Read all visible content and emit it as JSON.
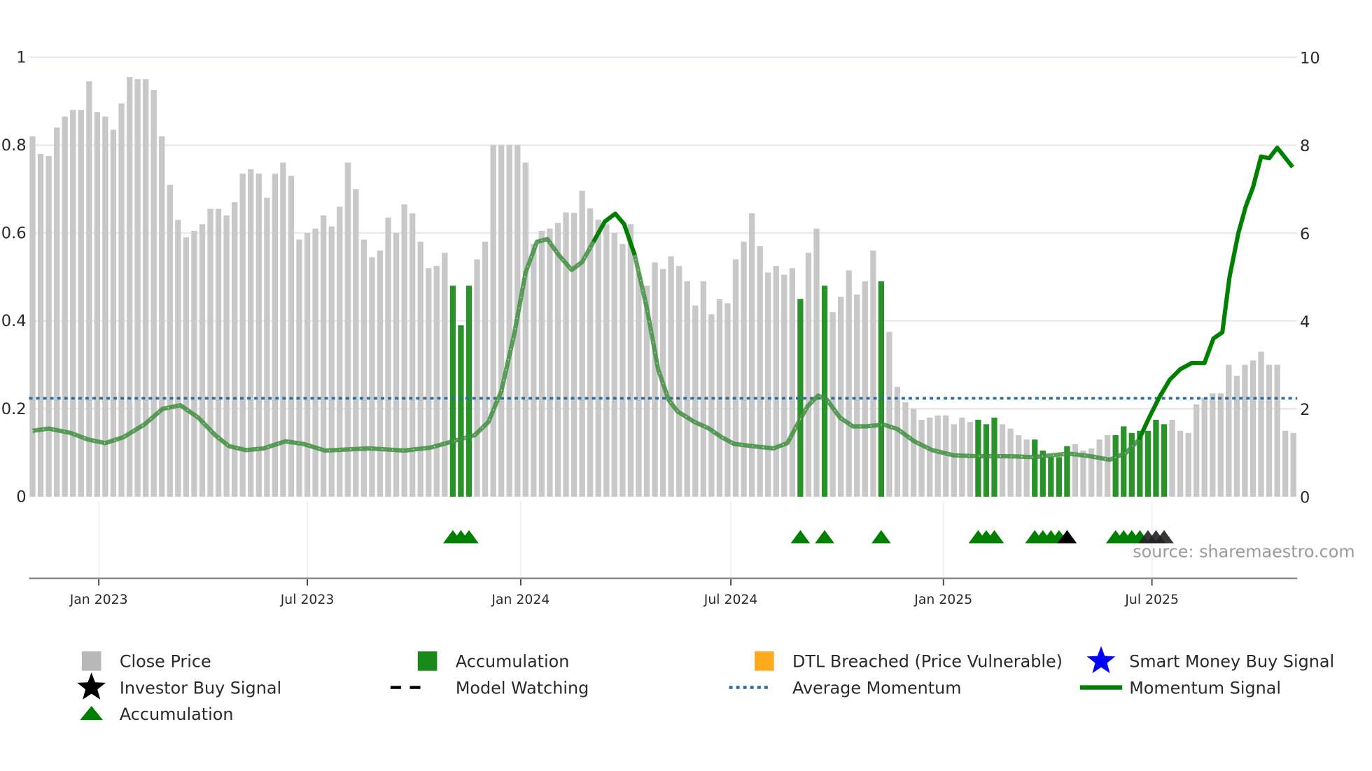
{
  "chart_data": {
    "type": "bar",
    "title": "",
    "source": "source: sharemaestro.com",
    "x_unit": "week index",
    "left_axis": {
      "ylim": [
        0,
        1
      ],
      "ticks": [
        "0",
        "0.2",
        "0.4",
        "0.6",
        "0.8",
        "1"
      ],
      "tick_values": [
        0,
        0.2,
        0.4,
        0.6,
        0.8,
        1
      ]
    },
    "right_axis": {
      "ylim": [
        0,
        10
      ],
      "ticks": [
        "0",
        "2",
        "4",
        "6",
        "8",
        "10"
      ],
      "tick_values": [
        0,
        2,
        4,
        6,
        8,
        10
      ]
    },
    "x_ticks": [
      {
        "label": "Jan 2023",
        "week": 8.2
      },
      {
        "label": "Jul 2023",
        "week": 34.0
      },
      {
        "label": "Jan 2024",
        "week": 60.4
      },
      {
        "label": "Jul 2024",
        "week": 86.4
      },
      {
        "label": "Jan 2025",
        "week": 112.7
      },
      {
        "label": "Jul 2025",
        "week": 138.5
      }
    ],
    "close_price": [
      0.82,
      0.78,
      0.775,
      0.84,
      0.865,
      0.88,
      0.88,
      0.945,
      0.875,
      0.865,
      0.835,
      0.895,
      0.955,
      0.95,
      0.95,
      0.925,
      0.82,
      0.71,
      0.63,
      0.59,
      0.605,
      0.62,
      0.655,
      0.655,
      0.64,
      0.67,
      0.735,
      0.745,
      0.735,
      0.68,
      0.735,
      0.76,
      0.73,
      0.585,
      0.6,
      0.61,
      0.64,
      0.615,
      0.66,
      0.76,
      0.7,
      0.585,
      0.545,
      0.56,
      0.635,
      0.6,
      0.665,
      0.645,
      0.58,
      0.52,
      0.525,
      0.555,
      0.48,
      0.39,
      0.48,
      0.54,
      0.58,
      0.8,
      0.8,
      0.8,
      0.8,
      0.76,
      0.575,
      0.605,
      0.61,
      0.623,
      0.647,
      0.646,
      0.696,
      0.656,
      0.63,
      0.62,
      0.6,
      0.575,
      0.62,
      0.51,
      0.48,
      0.533,
      0.518,
      0.547,
      0.525,
      0.49,
      0.435,
      0.49,
      0.415,
      0.45,
      0.44,
      0.54,
      0.58,
      0.645,
      0.57,
      0.51,
      0.525,
      0.505,
      0.52,
      0.45,
      0.555,
      0.61,
      0.48,
      0.42,
      0.455,
      0.515,
      0.46,
      0.49,
      0.56,
      0.49,
      0.375,
      0.25,
      0.215,
      0.2,
      0.175,
      0.18,
      0.185,
      0.185,
      0.165,
      0.18,
      0.17,
      0.175,
      0.165,
      0.18,
      0.165,
      0.155,
      0.14,
      0.13,
      0.13,
      0.105,
      0.09,
      0.09,
      0.115,
      0.12,
      0.105,
      0.11,
      0.13,
      0.14,
      0.14,
      0.16,
      0.145,
      0.15,
      0.15,
      0.175,
      0.165,
      0.175,
      0.15,
      0.145,
      0.21,
      0.225,
      0.235,
      0.235,
      0.3,
      0.275,
      0.3,
      0.31,
      0.33,
      0.3,
      0.3,
      0.15,
      0.145
    ],
    "accumulation_bars": [
      52,
      53,
      54,
      95,
      98,
      105,
      117,
      118,
      119,
      124,
      125,
      126,
      127,
      128,
      134,
      135,
      136,
      137,
      138,
      139,
      140
    ],
    "accumulation_markers": [
      52,
      53,
      54,
      95,
      98,
      105,
      117,
      118,
      119,
      124,
      125,
      126,
      127,
      134,
      135,
      136,
      137
    ],
    "investor_buy_markers": [
      128,
      138,
      139,
      140
    ],
    "average_momentum": 2.24,
    "momentum_signal": [
      [
        0,
        1.5
      ],
      [
        2,
        1.55
      ],
      [
        4.7,
        1.45
      ],
      [
        6.9,
        1.3
      ],
      [
        9,
        1.22
      ],
      [
        11.2,
        1.35
      ],
      [
        13.9,
        1.65
      ],
      [
        16.1,
        2.0
      ],
      [
        18.3,
        2.08
      ],
      [
        20.5,
        1.8
      ],
      [
        22.6,
        1.4
      ],
      [
        24.3,
        1.15
      ],
      [
        26.4,
        1.06
      ],
      [
        28.6,
        1.1
      ],
      [
        31.3,
        1.26
      ],
      [
        33.5,
        1.2
      ],
      [
        36.2,
        1.05
      ],
      [
        39.5,
        1.08
      ],
      [
        41.7,
        1.1
      ],
      [
        46,
        1.05
      ],
      [
        49.3,
        1.12
      ],
      [
        52,
        1.26
      ],
      [
        54.7,
        1.4
      ],
      [
        56.4,
        1.7
      ],
      [
        58,
        2.4
      ],
      [
        59.6,
        3.7
      ],
      [
        61,
        5.1
      ],
      [
        62.4,
        5.8
      ],
      [
        63.7,
        5.86
      ],
      [
        65.1,
        5.5
      ],
      [
        66.7,
        5.16
      ],
      [
        68,
        5.34
      ],
      [
        69.4,
        5.8
      ],
      [
        70.8,
        6.26
      ],
      [
        72.1,
        6.44
      ],
      [
        73.2,
        6.2
      ],
      [
        74.5,
        5.5
      ],
      [
        76,
        4.3
      ],
      [
        77.4,
        2.9
      ],
      [
        78.7,
        2.2
      ],
      [
        79.8,
        1.94
      ],
      [
        81.9,
        1.7
      ],
      [
        83.6,
        1.56
      ],
      [
        85.2,
        1.36
      ],
      [
        86.8,
        1.2
      ],
      [
        89.6,
        1.14
      ],
      [
        91.7,
        1.1
      ],
      [
        93.4,
        1.22
      ],
      [
        94.5,
        1.6
      ],
      [
        95.9,
        2.06
      ],
      [
        97.2,
        2.3
      ],
      [
        98.3,
        2.2
      ],
      [
        99.9,
        1.8
      ],
      [
        101.5,
        1.6
      ],
      [
        103.2,
        1.6
      ],
      [
        105.3,
        1.64
      ],
      [
        107,
        1.54
      ],
      [
        109.1,
        1.26
      ],
      [
        111.3,
        1.06
      ],
      [
        114,
        0.94
      ],
      [
        116.8,
        0.92
      ],
      [
        121.1,
        0.92
      ],
      [
        123.8,
        0.9
      ],
      [
        126,
        0.94
      ],
      [
        128.2,
        0.98
      ],
      [
        130.9,
        0.92
      ],
      [
        133.3,
        0.84
      ],
      [
        135.3,
        1.0
      ],
      [
        136.9,
        1.3
      ],
      [
        138,
        1.74
      ],
      [
        139.4,
        2.26
      ],
      [
        140.7,
        2.66
      ],
      [
        142,
        2.9
      ],
      [
        143.4,
        3.04
      ],
      [
        145,
        3.04
      ],
      [
        146.1,
        3.6
      ],
      [
        147.2,
        3.74
      ],
      [
        148.1,
        5.0
      ],
      [
        149.2,
        6.0
      ],
      [
        150.1,
        6.6
      ],
      [
        151,
        7.04
      ],
      [
        152,
        7.74
      ],
      [
        153,
        7.7
      ],
      [
        154,
        7.94
      ],
      [
        155.9,
        7.5
      ]
    ],
    "momentum_strong_ranges": [
      [
        69.4,
        74.5
      ],
      [
        136.9,
        155.9
      ]
    ],
    "colors": {
      "close": "#c8c8c8",
      "accumulation": "#1e8c1e",
      "marker_green": "#008000",
      "investor": "#000000",
      "avg": "#2e6e9e",
      "momentum": "#008000",
      "dtl": "#ffa91f",
      "smart_money": "#0000ff"
    },
    "legend": {
      "placement": "bottom",
      "items": [
        {
          "label": "Close Price",
          "icon": "gray-square"
        },
        {
          "label": "Accumulation",
          "icon": "green-square"
        },
        {
          "label": "DTL Breached (Price Vulnerable)",
          "icon": "orange-square"
        },
        {
          "label": "Smart Money Buy Signal",
          "icon": "blue-star"
        },
        {
          "label": "Investor Buy Signal",
          "icon": "black-star"
        },
        {
          "label": "Model Watching",
          "icon": "black-dash"
        },
        {
          "label": "Average Momentum",
          "icon": "blue-dots"
        },
        {
          "label": "Momentum Signal",
          "icon": "green-line"
        },
        {
          "label": "Accumulation",
          "icon": "green-triangle"
        }
      ]
    }
  }
}
